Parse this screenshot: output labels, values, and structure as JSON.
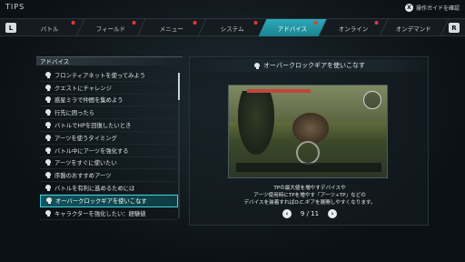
{
  "header": {
    "title": "TIPS",
    "guide_button": "X",
    "guide_label": "操作ガイドを確認"
  },
  "tabbar": {
    "left_button": "L",
    "right_button": "R",
    "tabs": [
      {
        "label": "バトル",
        "active": false,
        "dot": true
      },
      {
        "label": "フィールド",
        "active": false,
        "dot": true
      },
      {
        "label": "メニュー",
        "active": false,
        "dot": true
      },
      {
        "label": "システム",
        "active": false,
        "dot": true
      },
      {
        "label": "アドバイス",
        "active": true,
        "dot": true
      },
      {
        "label": "オンライン",
        "active": false,
        "dot": true
      },
      {
        "label": "オンデマンド",
        "active": false,
        "dot": false
      }
    ]
  },
  "left_panel": {
    "header": "アドバイス",
    "items": [
      "フロンティアネットを使ってみよう",
      "クエストにチャレンジ",
      "惑星ミラで仲間を集めよう",
      "行先に困ったら",
      "バトルでHPを回復したいとき",
      "アーツを使うタイミング",
      "バトル中にアーツを強化する",
      "アーツをすぐに使いたい",
      "序盤のおすすめアーツ",
      "バトルを有利に進めるためには",
      "オーバークロックギアを使いこなす",
      "キャラクターを強化したい：経験値"
    ],
    "selected_index": 10
  },
  "right_panel": {
    "title": "オーバークロックギアを使いこなす",
    "description_lines": [
      "TPの最大値を増やすデバイスや",
      "アーツ使用時にTPを増やす「アーツ+TP」などの",
      "デバイスを装着すればO.C.ギアを展開しやすくなります。"
    ],
    "pager": "9 / 11"
  },
  "colors": {
    "accent": "#2aa9b8",
    "selected_border": "#3fd0dc",
    "notification_dot": "#e53935"
  }
}
